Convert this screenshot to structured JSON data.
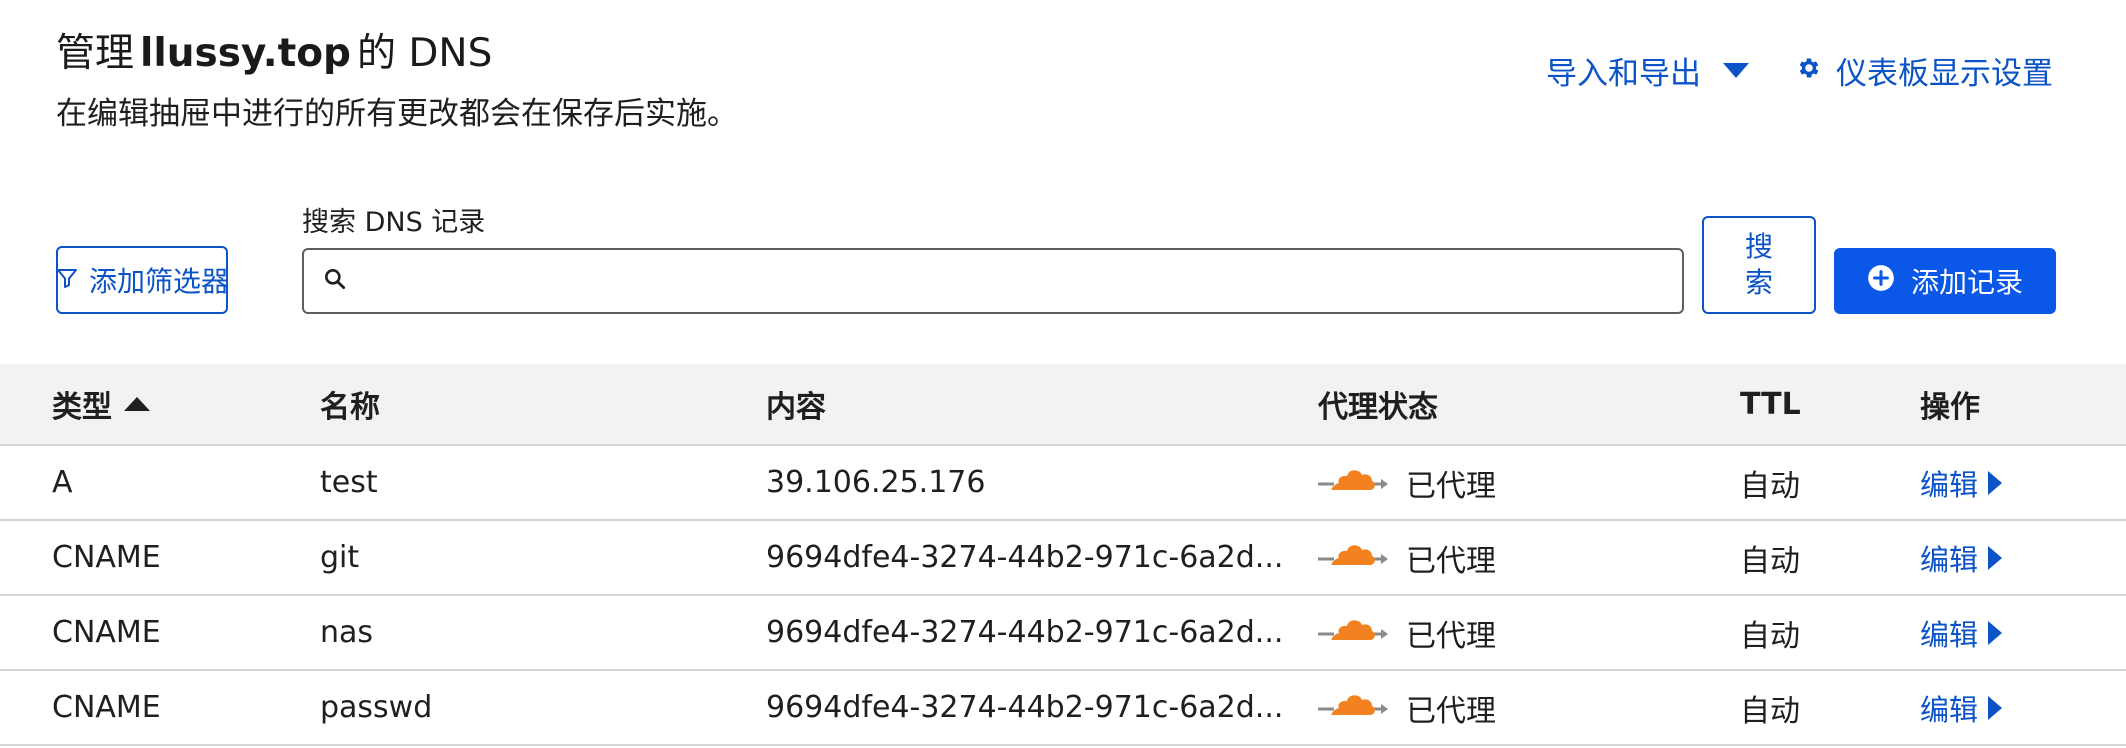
{
  "header": {
    "title_prefix": "管理",
    "domain": "llussy.top",
    "title_suffix": "的 DNS",
    "subtitle": "在编辑抽屉中进行的所有更改都会在保存后实施。"
  },
  "top_actions": {
    "import_export_label": "导入和导出",
    "dashboard_settings_label": "仪表板显示设置"
  },
  "search": {
    "label": "搜索 DNS 记录",
    "placeholder": "",
    "value": "",
    "filter_button_label": "添加筛选器",
    "search_button_label": "搜索",
    "add_record_label": "添加记录"
  },
  "table": {
    "headers": {
      "type": "类型",
      "name": "名称",
      "content": "内容",
      "proxy_status": "代理状态",
      "ttl": "TTL",
      "actions": "操作"
    },
    "rows": [
      {
        "type": "A",
        "name": "test",
        "content": "39.106.25.176",
        "proxy_status": "已代理",
        "ttl": "自动",
        "action": "编辑"
      },
      {
        "type": "CNAME",
        "name": "git",
        "content": "9694dfe4-3274-44b2-971c-6a2d...",
        "proxy_status": "已代理",
        "ttl": "自动",
        "action": "编辑"
      },
      {
        "type": "CNAME",
        "name": "nas",
        "content": "9694dfe4-3274-44b2-971c-6a2d...",
        "proxy_status": "已代理",
        "ttl": "自动",
        "action": "编辑"
      },
      {
        "type": "CNAME",
        "name": "passwd",
        "content": "9694dfe4-3274-44b2-971c-6a2d...",
        "proxy_status": "已代理",
        "ttl": "自动",
        "action": "编辑"
      }
    ]
  },
  "colors": {
    "link_blue": "#0b53c7",
    "primary_button": "#0b57e8",
    "proxy_cloud": "#f48120",
    "header_bg": "#f2f2f2"
  },
  "icons": {
    "filter": "filter-icon",
    "search": "search-icon",
    "gear": "gear-icon",
    "add": "plus-circle-icon",
    "proxied": "proxied-cloud-icon",
    "sort": "sort-ascending-icon",
    "dropdown": "chevron-down-icon",
    "edit_caret": "chevron-right-icon"
  }
}
